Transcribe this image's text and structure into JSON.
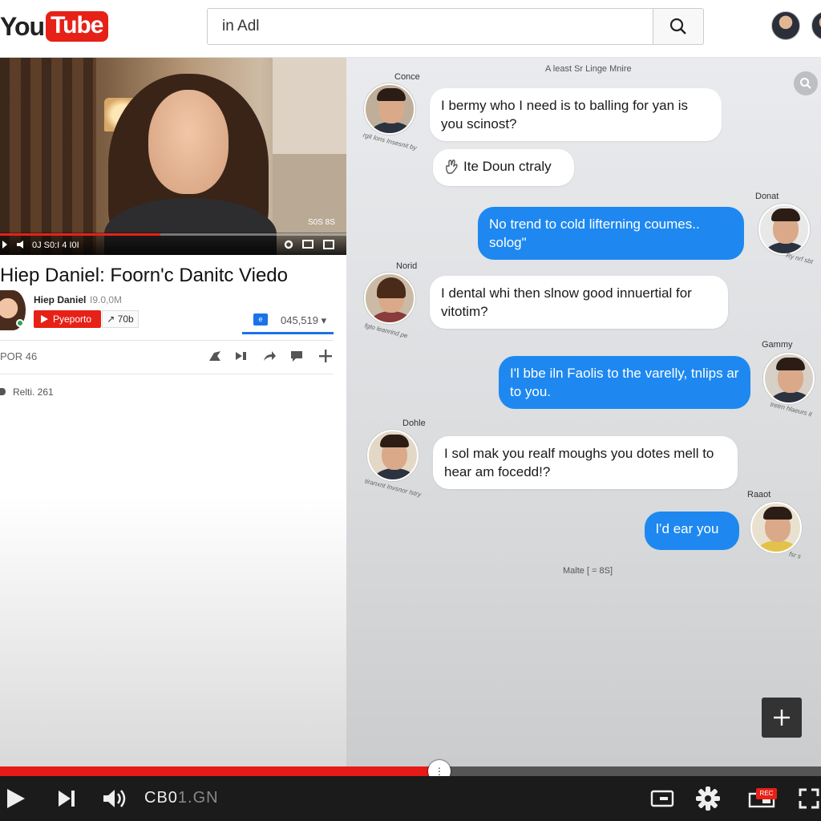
{
  "header": {
    "logo_you": "You",
    "logo_tube": "Tube",
    "search_value": "in Adl"
  },
  "video": {
    "time": "0J S0:I 4 I0I",
    "badge": "S0S 8S"
  },
  "video_info": {
    "title": "Hiep Daniel: Foorn'c Danitc Viedo",
    "channel_name": "Hiep Daniel",
    "channel_subs": "I9.0,0M",
    "subscribe_label": "Pyeporto",
    "share_label": "↗ 70b",
    "views_icon": "e",
    "views": "045,519 ▾",
    "for_label": "POR 46",
    "related_label": "Relti. 261"
  },
  "chat": {
    "header": "A least Sr Linge Mnire",
    "messages": [
      {
        "sender": "Conce",
        "side": "in",
        "text": "I bermy who I need is to balling for yan is you scinost?",
        "scribble": "rgit lons Insesnit by"
      },
      {
        "sender": "",
        "side": "in",
        "text": "Ite Doun ctraly",
        "icon": "hand-icon"
      },
      {
        "sender": "Donat",
        "side": "out",
        "text": "No trend to cold lifterning coumes.. solog\"",
        "scribble": "Ry nrf sbt"
      },
      {
        "sender": "Norid",
        "side": "in",
        "text": "I dental whi then slnow good innuertial for vitotim?",
        "scribble": "fgto leanrind pe"
      },
      {
        "sender": "Gammy",
        "side": "out",
        "text": "I'l bbe iln Faolis to the varelly, tnlips ar to you.",
        "scribble": "tretrn hlaeurs it"
      },
      {
        "sender": "Dohle",
        "side": "in",
        "text": "I sol mak you realf moughs you dotes mell to hear am focedd!?",
        "scribble": "tiranxnt Invsnor Istry"
      },
      {
        "sender": "Raaot",
        "side": "out",
        "text": "l’d ear you",
        "scribble": "fsr s"
      }
    ],
    "footer": "Malte [ =   8S]"
  },
  "player": {
    "progress_percent": 53.5,
    "time_main": "CB0",
    "time_dim": "1.GN",
    "live_badge": "REC"
  },
  "colors": {
    "brand_red": "#e62117",
    "bubble_blue": "#1e88f0"
  }
}
